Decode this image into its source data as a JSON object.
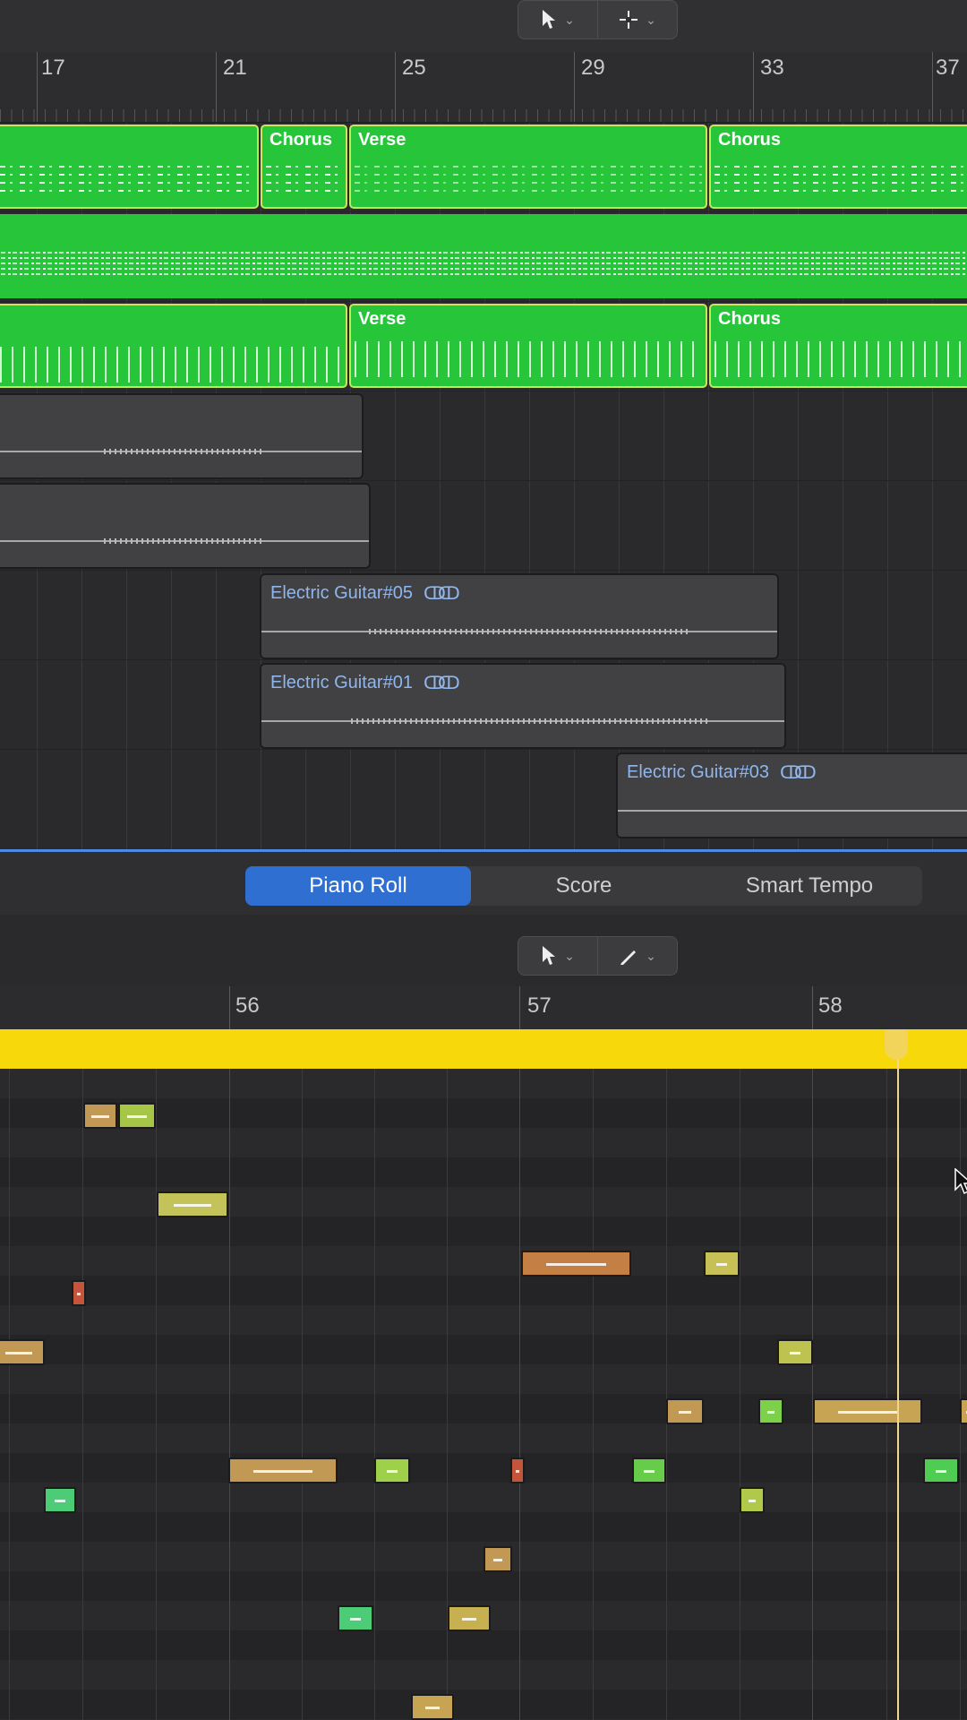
{
  "top_toolbar": {
    "pointer_tool_icon": "pointer-arrow-icon",
    "secondary_tool_icon": "crosshair-icon",
    "chevron": "⌄"
  },
  "tracks_ruler": {
    "bars": [
      "17",
      "21",
      "25",
      "29",
      "33",
      "37"
    ]
  },
  "regions": {
    "row1": [
      {
        "name": ""
      },
      {
        "name": "Chorus"
      },
      {
        "name": "Verse"
      },
      {
        "name": "Chorus"
      }
    ],
    "row3": [
      {
        "name": ""
      },
      {
        "name": "Verse"
      },
      {
        "name": "Chorus"
      }
    ],
    "audio": [
      {
        "name": "Electric Guitar#05"
      },
      {
        "name": "Electric Guitar#01"
      },
      {
        "name": "Electric Guitar#03"
      }
    ],
    "loop_icon": "ↀↀ"
  },
  "editor": {
    "tabs": [
      "Piano Roll",
      "Score",
      "Smart Tempo"
    ],
    "active_tab": "Piano Roll",
    "pointer_tool_icon": "pointer-arrow-icon",
    "pencil_tool_icon": "pencil-icon",
    "ruler_bars": [
      "56",
      "57",
      "58"
    ]
  },
  "colors": {
    "accent_blue": "#2f6fd1",
    "region_green": "#27c53a",
    "region_strip_yellow": "#f7d90b"
  }
}
